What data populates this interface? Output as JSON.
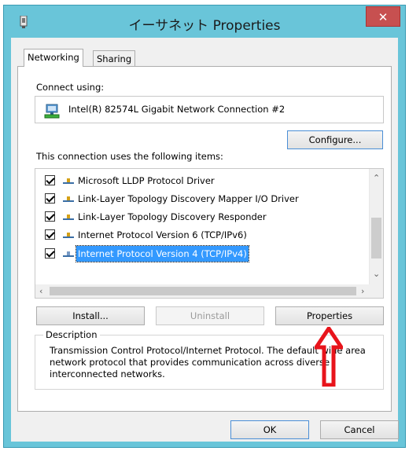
{
  "window": {
    "title": "イーサネット Properties",
    "close_label": "✕"
  },
  "tabs": [
    {
      "label": "Networking"
    },
    {
      "label": "Sharing"
    }
  ],
  "connect": {
    "label": "Connect using:",
    "adapter_name": "Intel(R) 82574L Gigabit Network Connection #2",
    "configure_label": "Configure..."
  },
  "items": {
    "label": "This connection uses the following items:",
    "list": [
      {
        "label": "Microsoft LLDP Protocol Driver",
        "checked": true
      },
      {
        "label": "Link-Layer Topology Discovery Mapper I/O Driver",
        "checked": true
      },
      {
        "label": "Link-Layer Topology Discovery Responder",
        "checked": true
      },
      {
        "label": "Internet Protocol Version 6 (TCP/IPv6)",
        "checked": true
      },
      {
        "label": "Internet Protocol Version 4 (TCP/IPv4)",
        "checked": true,
        "selected": true
      }
    ]
  },
  "actions": {
    "install_label": "Install...",
    "uninstall_label": "Uninstall",
    "properties_label": "Properties"
  },
  "description": {
    "title": "Description",
    "text": "Transmission Control Protocol/Internet Protocol. The default wide area network protocol that provides communication across diverse interconnected networks."
  },
  "footer": {
    "ok_label": "OK",
    "cancel_label": "Cancel"
  },
  "colors": {
    "titlebar": "#69c5d9",
    "close": "#c75050",
    "selection": "#3399ff",
    "annotation_arrow": "#e8141b"
  }
}
